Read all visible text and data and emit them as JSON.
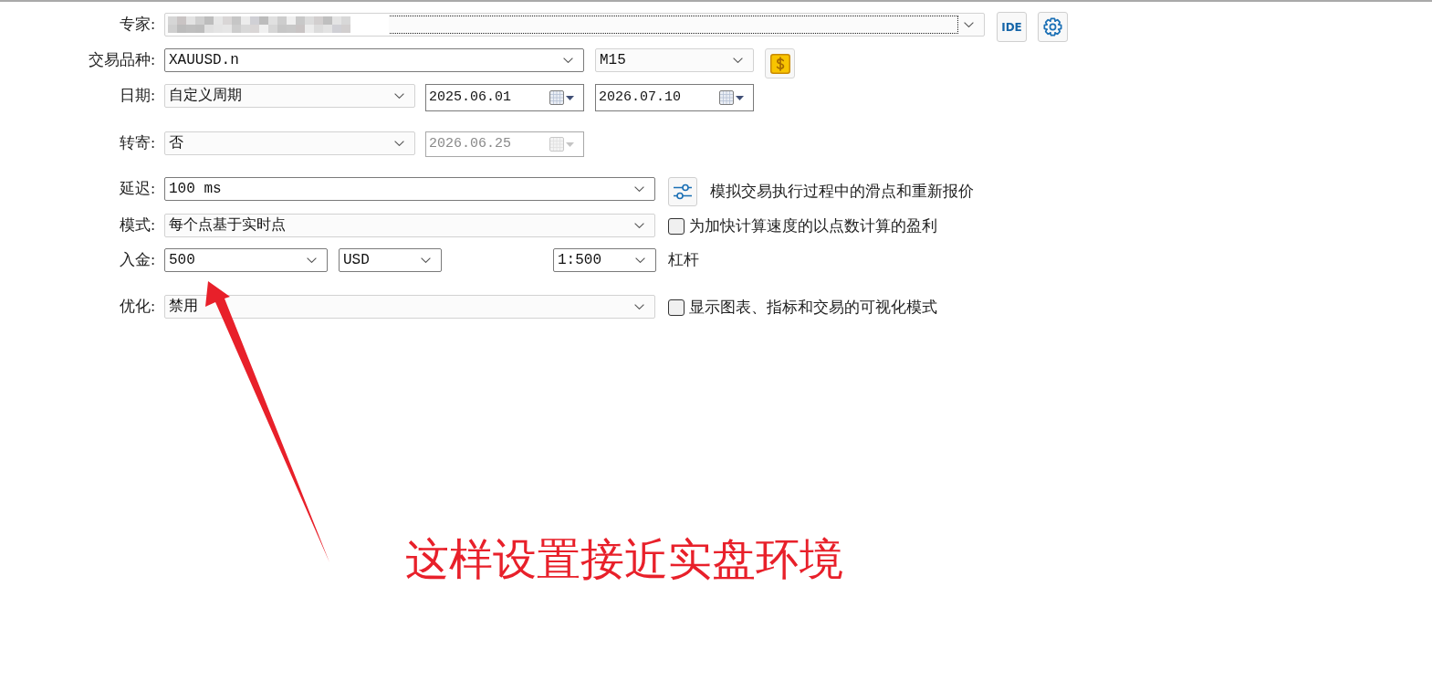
{
  "rows": [
    {
      "label": "专家:",
      "controls": [
        {
          "kind": "combo",
          "editable": false,
          "focused": true
        },
        {
          "kind": "textbutton",
          "text": "IDE"
        },
        {
          "kind": "gearbutton"
        }
      ]
    },
    {
      "label": "交易品种:",
      "controls": [
        {
          "kind": "combo",
          "editable": true,
          "focused": false,
          "value": "XAUUSD.n"
        },
        {
          "kind": "combo",
          "editable": false,
          "focused": false,
          "value": "M15"
        },
        {
          "kind": "dollarbutton"
        }
      ]
    },
    {
      "label": "日期:",
      "controls": [
        {
          "kind": "combo",
          "editable": false,
          "focused": false,
          "value": "自定义周期"
        },
        {
          "kind": "date",
          "value": "2025.06.01",
          "disabled": false
        },
        {
          "kind": "date",
          "value": "2026.07.10",
          "disabled": false
        }
      ]
    },
    {
      "label": "转寄:",
      "controls": [
        {
          "kind": "combo",
          "editable": false,
          "focused": false,
          "value": "否"
        },
        {
          "kind": "date",
          "value": "2026.06.25",
          "disabled": true
        }
      ]
    },
    {
      "label": "延迟:",
      "controls": [
        {
          "kind": "combo",
          "editable": true,
          "focused": false,
          "value": "100 ms"
        },
        {
          "kind": "sliderbutton"
        },
        {
          "kind": "note",
          "text": "模拟交易执行过程中的滑点和重新报价"
        }
      ]
    },
    {
      "label": "模式:",
      "controls": [
        {
          "kind": "combo",
          "editable": false,
          "focused": false,
          "value": "每个点基于实时点"
        },
        {
          "kind": "checkbox",
          "checked": false,
          "text": "为加快计算速度的以点数计算的盈利"
        }
      ]
    },
    {
      "label": "入金:",
      "controls": [
        {
          "kind": "combo",
          "editable": true,
          "focused": false,
          "value": "500"
        },
        {
          "kind": "combo",
          "editable": true,
          "focused": false,
          "value": "USD"
        },
        {
          "kind": "combo",
          "editable": true,
          "focused": false,
          "value": "1:500"
        },
        {
          "kind": "note",
          "text": "杠杆"
        }
      ]
    },
    {
      "label": "优化:",
      "controls": [
        {
          "kind": "combo",
          "editable": false,
          "focused": false,
          "value": "禁用"
        },
        {
          "kind": "checkbox",
          "checked": false,
          "text": "显示图表、指标和交易的可视化模式"
        }
      ]
    }
  ],
  "annotation": {
    "text": "这样设置接近实盘环境"
  }
}
